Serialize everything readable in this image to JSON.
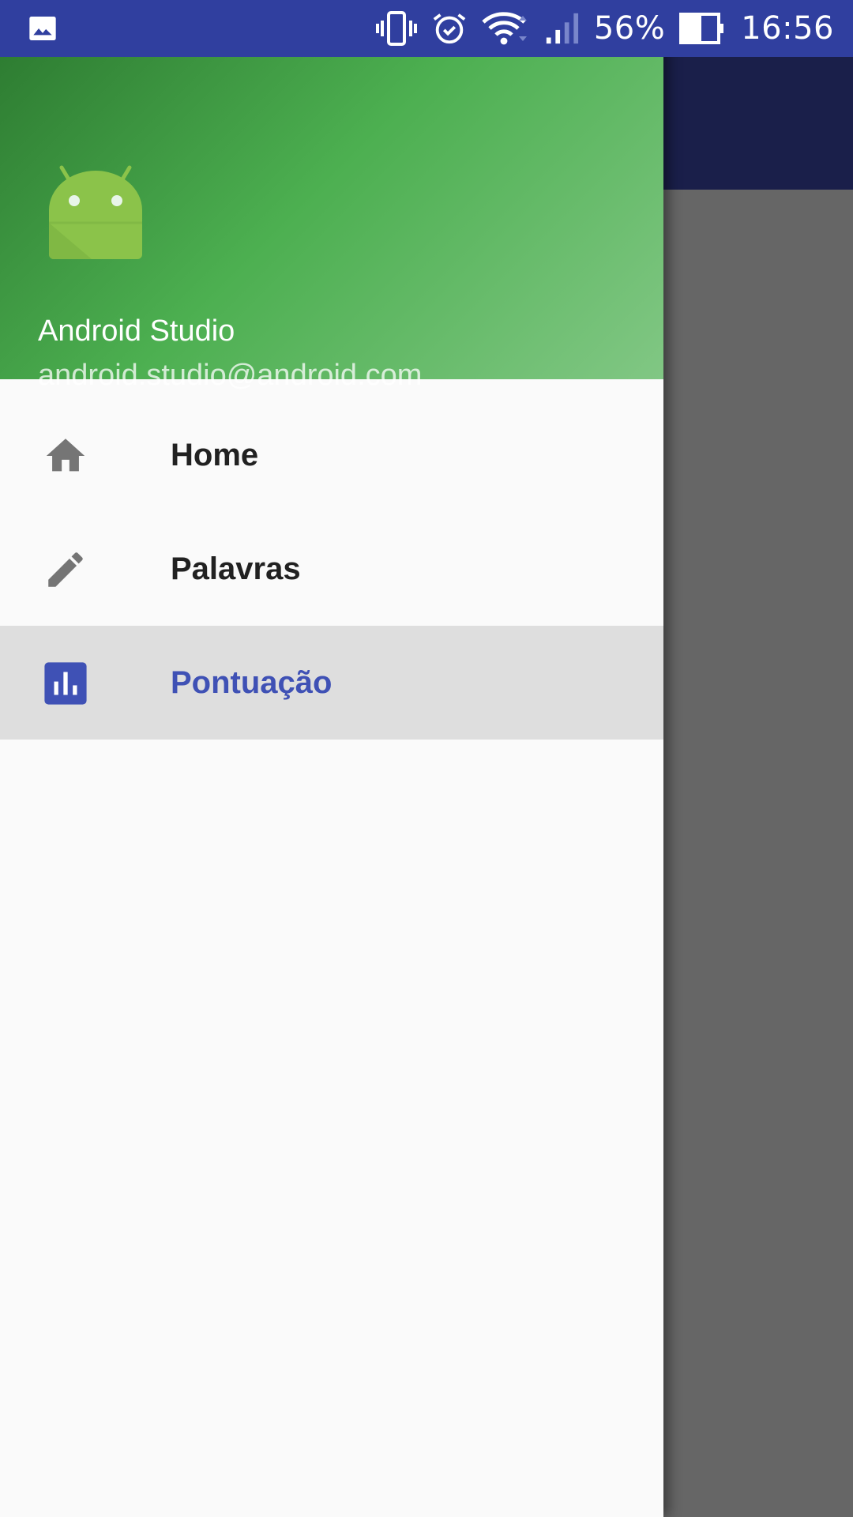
{
  "status_bar": {
    "battery_percent": "56%",
    "time": "16:56",
    "icons": [
      "image-icon",
      "vibrate-icon",
      "alarm-icon",
      "wifi-icon",
      "signal-icon",
      "battery-icon"
    ]
  },
  "drawer": {
    "header": {
      "name": "Android Studio",
      "email": "android.studio@android.com",
      "avatar_icon": "android-logo-icon"
    },
    "menu": [
      {
        "label": "Home",
        "icon": "home-icon",
        "selected": false
      },
      {
        "label": "Palavras",
        "icon": "pencil-icon",
        "selected": false
      },
      {
        "label": "Pontuação",
        "icon": "bar-chart-icon",
        "selected": true
      }
    ]
  },
  "colors": {
    "status_bar": "#303f9f",
    "header_gradient_start": "#2e7d32",
    "header_gradient_end": "#81c784",
    "accent": "#3f51b5",
    "selected_bg": "#dedede",
    "icon_gray": "#757575"
  }
}
